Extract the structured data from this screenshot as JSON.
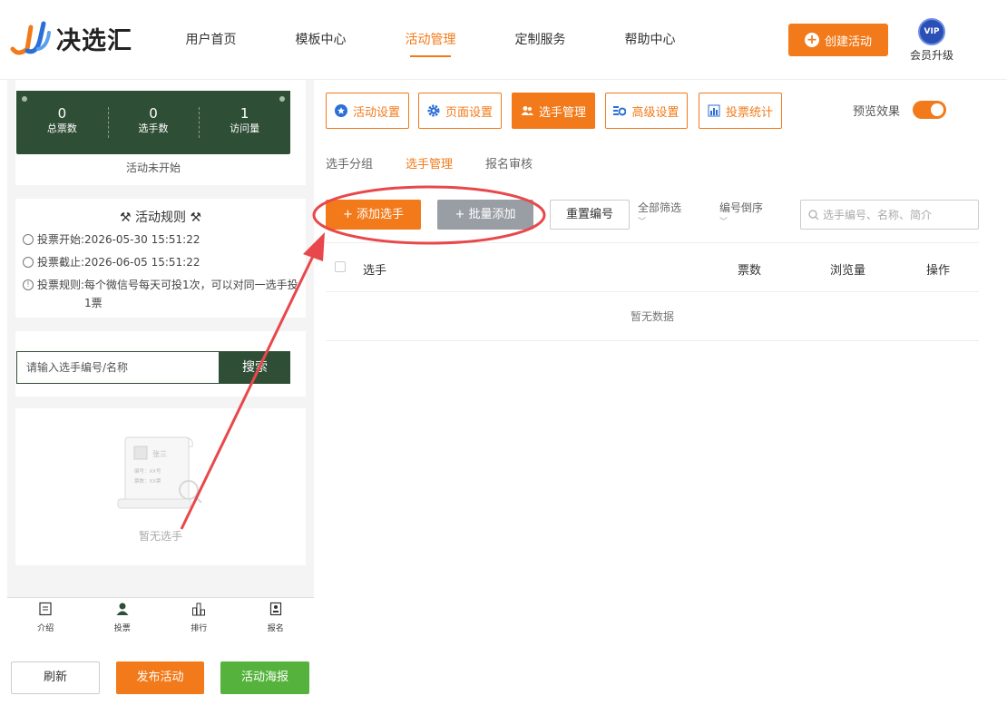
{
  "header": {
    "logo_text": "决选汇",
    "nav": [
      {
        "label": "用户首页",
        "active": false
      },
      {
        "label": "模板中心",
        "active": false
      },
      {
        "label": "活动管理",
        "active": true
      },
      {
        "label": "定制服务",
        "active": false
      },
      {
        "label": "帮助中心",
        "active": false
      }
    ],
    "create_label": "创建活动",
    "vip_badge": "VIP",
    "vip_label": "会员升级"
  },
  "preview_panel": {
    "stats": [
      {
        "value": "0",
        "label": "总票数"
      },
      {
        "value": "0",
        "label": "选手数"
      },
      {
        "value": "1",
        "label": "访问量"
      }
    ],
    "status": "活动未开始",
    "rules_title": "活动规则",
    "rules": [
      {
        "label": "投票开始:",
        "value": "2026-05-30 15:51:22"
      },
      {
        "label": "投票截止:",
        "value": "2026-06-05 15:51:22"
      },
      {
        "label": "投票规则:",
        "value": "每个微信号每天可投1次，可以对同一选手投1票"
      }
    ],
    "search_placeholder": "请输入选手编号/名称",
    "search_button": "搜索",
    "illustration": {
      "name": "张三",
      "line1": "编号：XX号",
      "line2": "票数：XX票"
    },
    "empty_text": "暂无选手",
    "tabs": [
      {
        "label": "介绍",
        "icon": "document-icon"
      },
      {
        "label": "投票",
        "icon": "user-icon"
      },
      {
        "label": "排行",
        "icon": "bar-chart-icon"
      },
      {
        "label": "报名",
        "icon": "signup-icon"
      }
    ]
  },
  "bottom_buttons": {
    "refresh": "刷新",
    "publish": "发布活动",
    "poster": "活动海报"
  },
  "toolbar": {
    "buttons": [
      {
        "label": "活动设置",
        "icon": "star-icon",
        "active": false
      },
      {
        "label": "页面设置",
        "icon": "gear-icon",
        "active": false
      },
      {
        "label": "选手管理",
        "icon": "users-icon",
        "active": true
      },
      {
        "label": "高级设置",
        "icon": "advanced-settings-icon",
        "active": false
      },
      {
        "label": "投票统计",
        "icon": "bar-chart-icon",
        "active": false
      }
    ],
    "preview_label": "预览效果",
    "preview_on": true
  },
  "subtabs": [
    {
      "label": "选手分组",
      "active": false
    },
    {
      "label": "选手管理",
      "active": true
    },
    {
      "label": "报名审核",
      "active": false
    }
  ],
  "actions": {
    "add": "+ 添加选手",
    "batch": "+ 批量添加",
    "reset": "重置编号",
    "filter": "全部筛选",
    "sort": "编号倒序",
    "search_placeholder": "选手编号、名称、简介"
  },
  "table": {
    "columns": [
      "选手",
      "票数",
      "浏览量",
      "操作"
    ],
    "empty": "暂无数据"
  },
  "colors": {
    "accent": "#f27a1a",
    "dark_green": "#2f4e36",
    "green": "#55b33d",
    "gray_button": "#999ea5",
    "annotation_red": "#e8484b"
  }
}
